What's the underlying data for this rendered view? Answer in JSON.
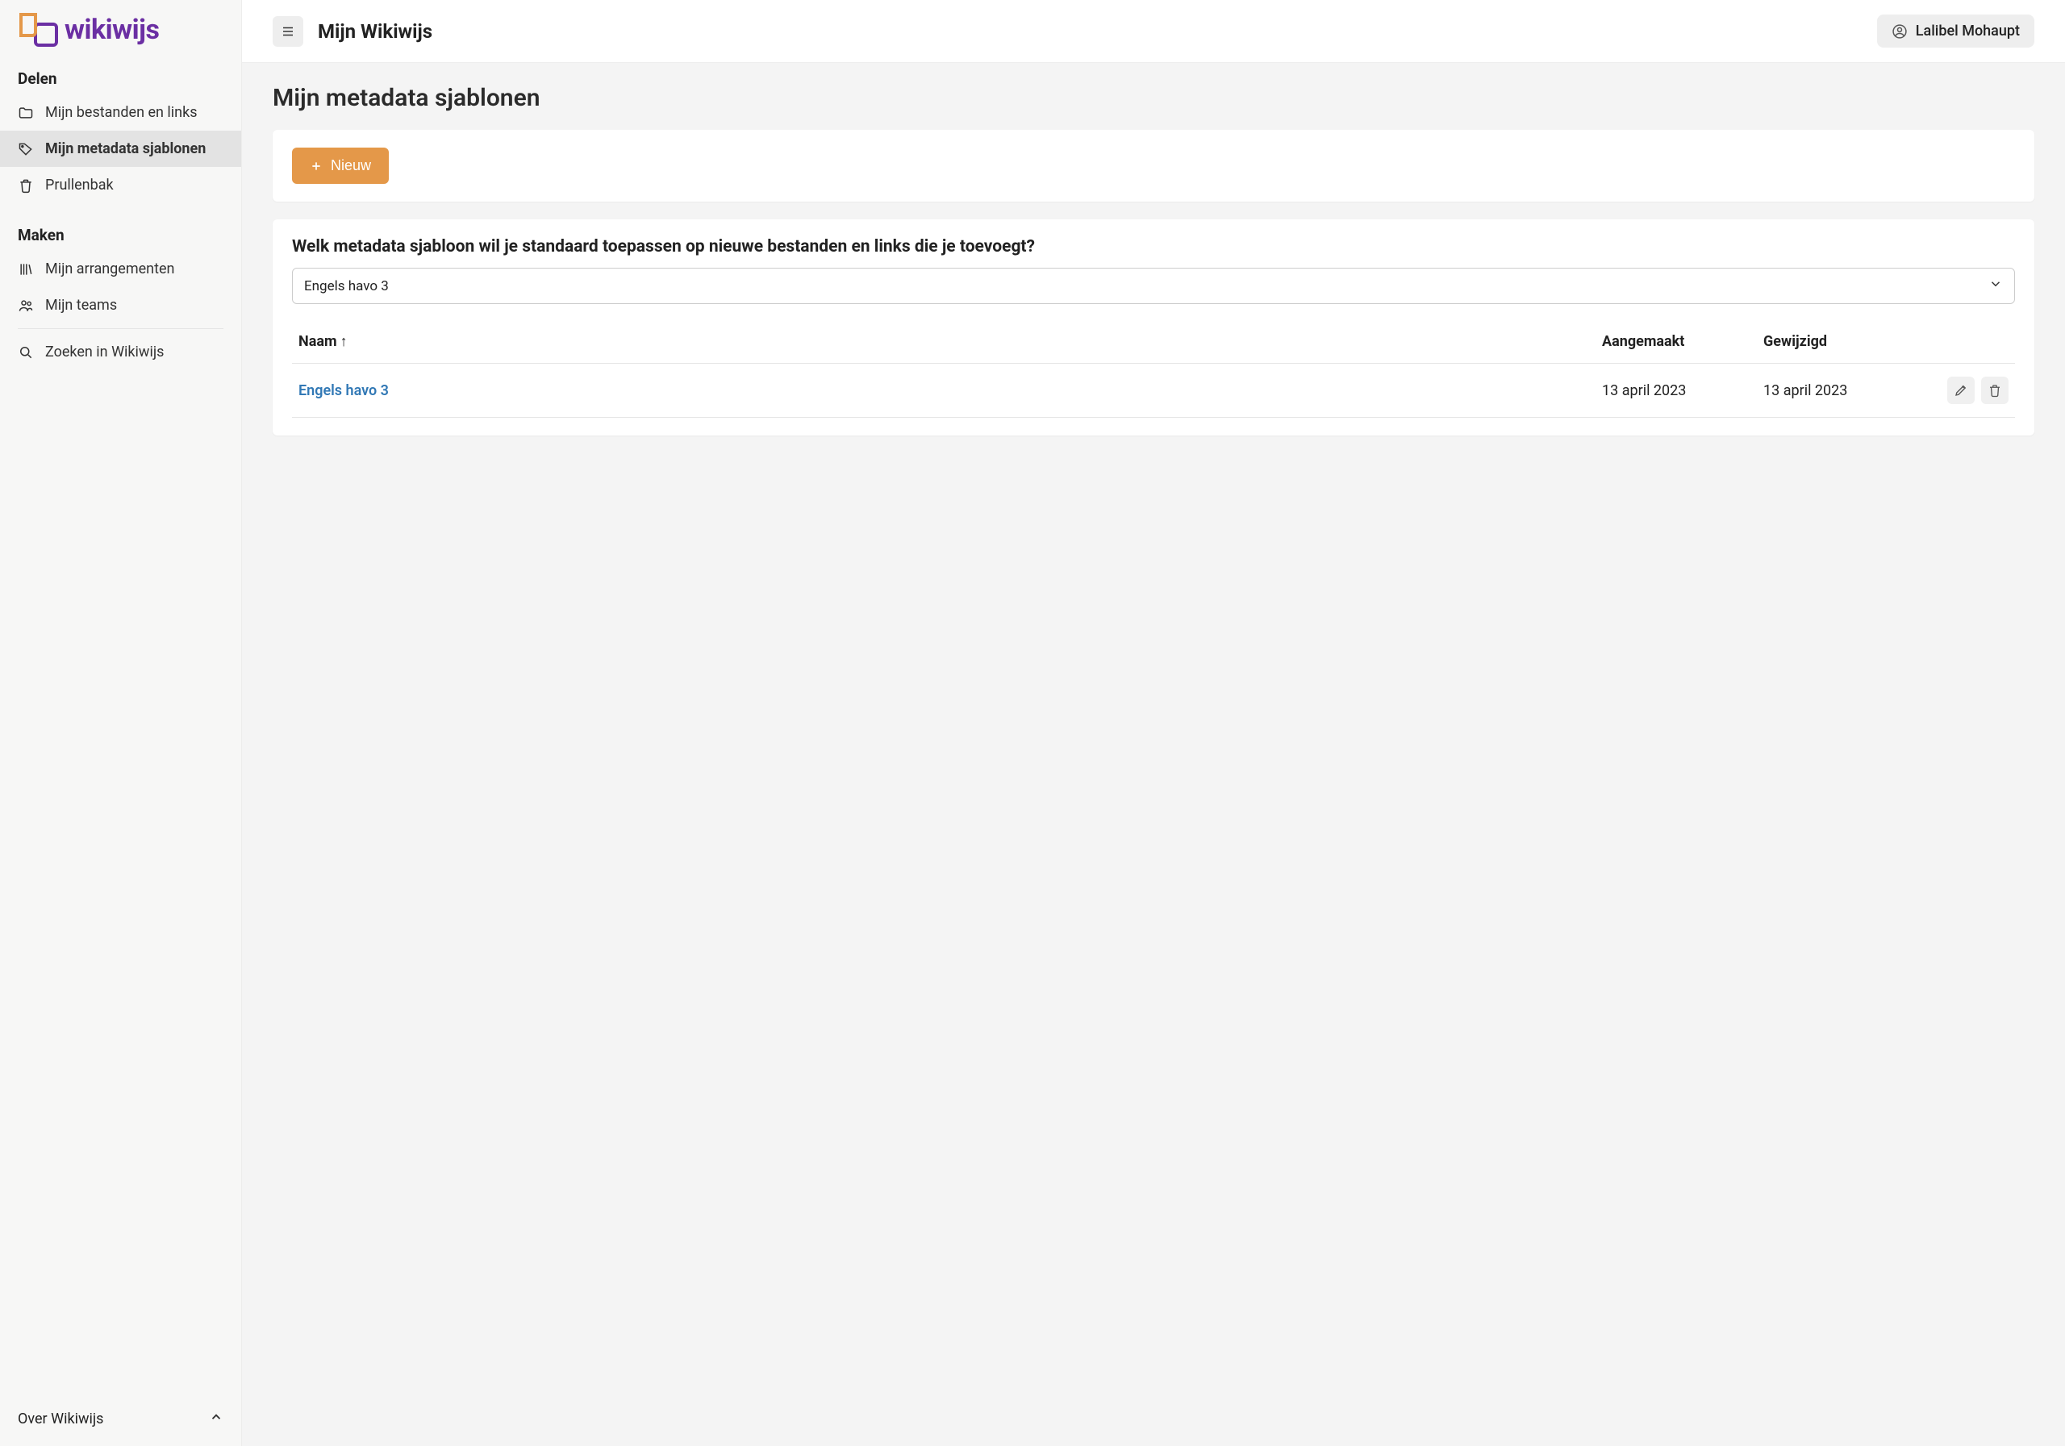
{
  "brand": {
    "name": "wikiwijs"
  },
  "sidebar": {
    "section_delen": "Delen",
    "section_maken": "Maken",
    "delen_items": [
      {
        "label": "Mijn bestanden en links",
        "icon": "folder",
        "active": false
      },
      {
        "label": "Mijn metadata sjablonen",
        "icon": "tag",
        "active": true
      },
      {
        "label": "Prullenbak",
        "icon": "trash",
        "active": false
      }
    ],
    "maken_items": [
      {
        "label": "Mijn arrangementen",
        "icon": "books",
        "active": false
      },
      {
        "label": "Mijn teams",
        "icon": "people",
        "active": false
      }
    ],
    "search_label": "Zoeken in Wikiwijs",
    "footer_label": "Over Wikiwijs"
  },
  "header": {
    "app_title": "Mijn Wikiwijs",
    "user_name": "Lalibel Mohaupt"
  },
  "page": {
    "title": "Mijn metadata sjablonen",
    "new_button": "Nieuw",
    "question": "Welk metadata sjabloon wil je standaard toepassen op nieuwe bestanden en links die je toevoegt?",
    "select_value": "Engels havo 3",
    "table": {
      "col_name": "Naam",
      "sort_indicator": "↑",
      "col_created": "Aangemaakt",
      "col_modified": "Gewijzigd",
      "rows": [
        {
          "name": "Engels havo 3",
          "created": "13 april 2023",
          "modified": "13 april 2023"
        }
      ]
    }
  }
}
